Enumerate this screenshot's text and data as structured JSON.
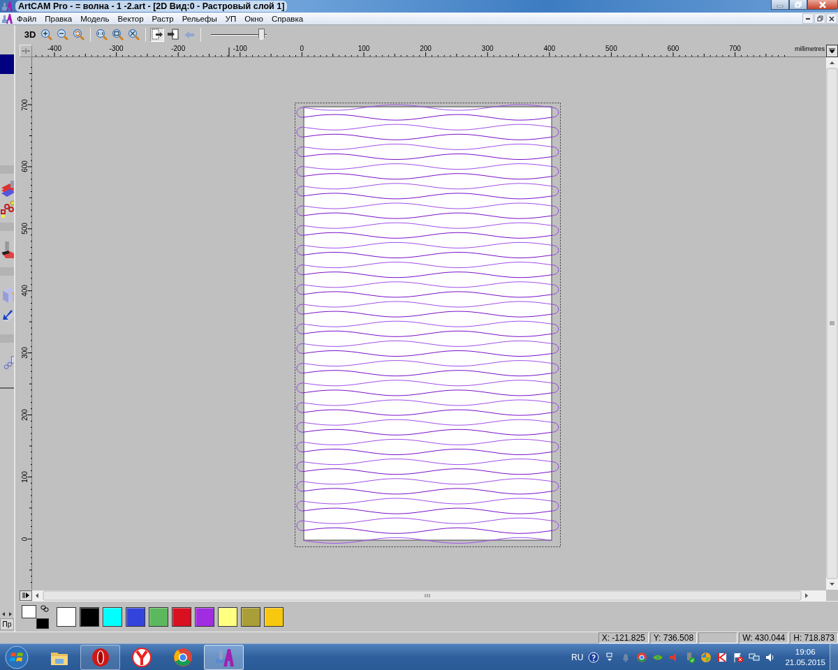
{
  "window": {
    "title": "ArtCAM Pro - = волна - 1 -2.art - [2D Вид:0 - Растровый слой 1]"
  },
  "menu": [
    "Файл",
    "Правка",
    "Модель",
    "Вектор",
    "Растр",
    "Рельефы",
    "УП",
    "Окно",
    "Справка"
  ],
  "toolbar": {
    "tools": [
      {
        "kind": "text",
        "label": "3D",
        "selected": false
      },
      {
        "kind": "zoomin",
        "selected": false
      },
      {
        "kind": "zoomout",
        "selected": false
      },
      {
        "kind": "zoomprev",
        "selected": false
      },
      {
        "kind": "zoomactual",
        "selected": false
      },
      {
        "kind": "zoombox",
        "selected": false
      },
      {
        "kind": "zoomfit",
        "selected": false
      },
      {
        "kind": "select",
        "selected": true
      },
      {
        "kind": "transform",
        "selected": false
      },
      {
        "kind": "view",
        "selected": false
      }
    ],
    "slider": {
      "level": 0.95
    }
  },
  "ruler": {
    "horizontal_labels": [
      "-400",
      "-300",
      "-200",
      "-100",
      "0",
      "100",
      "200",
      "300",
      "400",
      "500",
      "600",
      "700"
    ],
    "unit": "millimetres",
    "vertical_labels": [
      "700",
      "600",
      "500",
      "400",
      "300",
      "200",
      "100",
      "0"
    ]
  },
  "side_panel": {
    "tab": "Пр"
  },
  "palette": {
    "current": [
      {
        "color": "#ffffff"
      },
      {
        "color": "#000000"
      }
    ],
    "swatches": [
      {
        "color": "#ffffff"
      },
      {
        "color": "#000000"
      },
      {
        "color": "#00ffff"
      },
      {
        "color": "#3344dd"
      },
      {
        "color": "#5cb85c"
      },
      {
        "color": "#d81020"
      },
      {
        "color": "#a02ee0"
      },
      {
        "color": "#ffff80"
      },
      {
        "color": "#aa9e38"
      },
      {
        "color": "#f8c810"
      }
    ]
  },
  "status_bar": {
    "x": "X: -121.825",
    "y": "Y: 736.508",
    "w": "W: 430.044",
    "h": "H: 718.873"
  },
  "taskbar": {
    "apps": [
      {
        "kind": "explorer",
        "running": false,
        "selected": false
      },
      {
        "kind": "opera",
        "running": true,
        "selected": false
      },
      {
        "kind": "yandex",
        "running": false,
        "selected": false
      },
      {
        "kind": "chrome",
        "running": false,
        "selected": false
      },
      {
        "kind": "artcam",
        "running": true,
        "selected": true
      }
    ],
    "language": "RU",
    "time": "19:06",
    "date": "21.05.2015"
  }
}
